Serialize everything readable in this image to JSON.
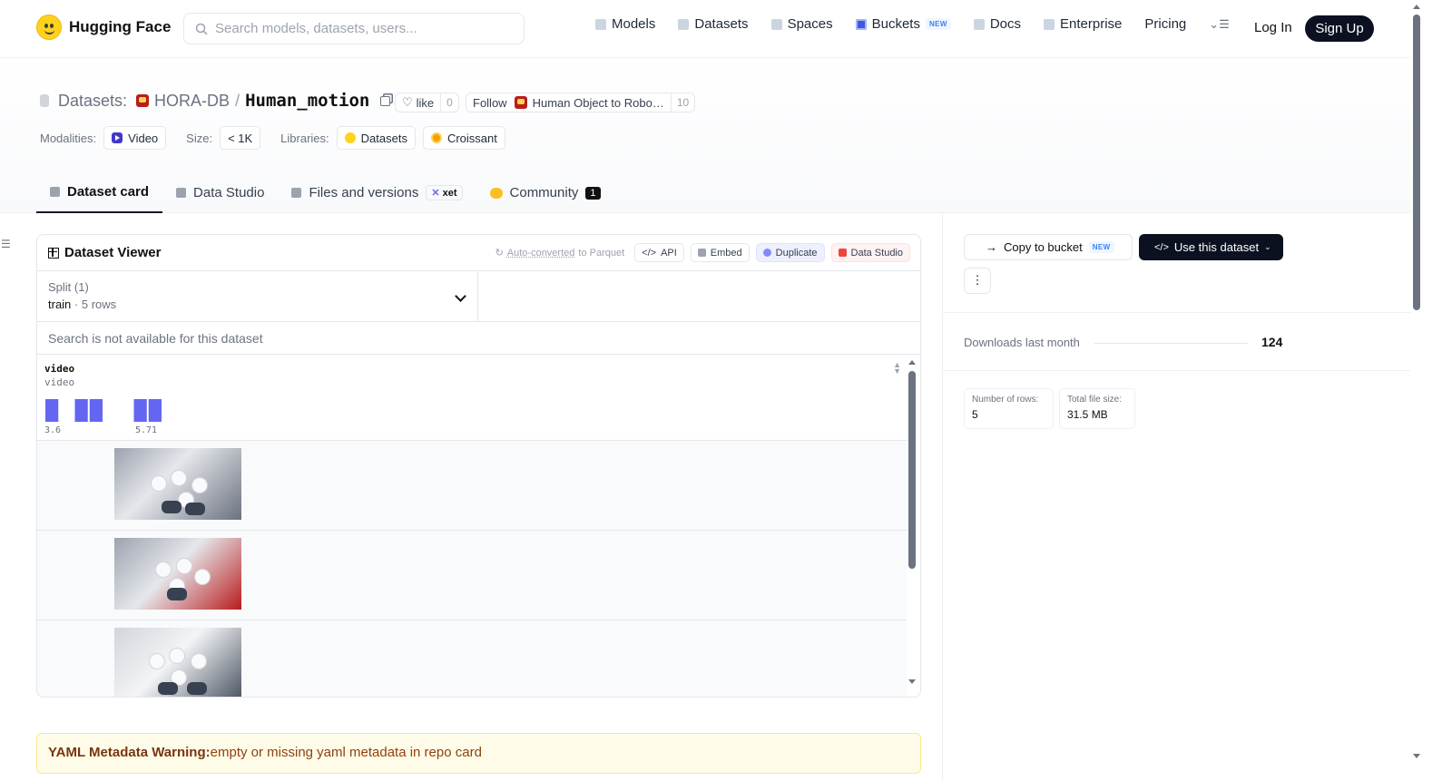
{
  "nav": {
    "brand": "Hugging Face",
    "search_placeholder": "Search models, datasets, users...",
    "links": [
      "Models",
      "Datasets",
      "Spaces",
      "Buckets",
      "Docs",
      "Enterprise",
      "Pricing"
    ],
    "buckets_badge": "NEW",
    "login": "Log In",
    "signup": "Sign Up"
  },
  "header": {
    "section": "Datasets:",
    "org": "HORA-DB",
    "slash": "/",
    "name": "Human_motion",
    "like_label": "like",
    "like_count": "0",
    "follow_label": "Follow",
    "follow_org": "Human Object to Robo…",
    "follow_count": "10",
    "modalities_label": "Modalities:",
    "modality": "Video",
    "size_label": "Size:",
    "size": "< 1K",
    "libraries_label": "Libraries:",
    "library_1": "Datasets",
    "library_2": "Croissant"
  },
  "tabs": {
    "card": "Dataset card",
    "studio": "Data Studio",
    "files": "Files and versions",
    "xet_badge_icon": "✕",
    "xet_badge": "xet",
    "community": "Community",
    "community_count": "1"
  },
  "viewer": {
    "title": "Dataset Viewer",
    "auto_converted": "Auto-converted",
    "to_parquet": "to Parquet",
    "api": "API",
    "embed": "Embed",
    "duplicate": "Duplicate",
    "data_studio": "Data Studio",
    "split_label": "Split (1)",
    "split_value": "train",
    "split_sep": "·",
    "split_rows": "5 rows",
    "search_disabled": "Search is not available for this dataset",
    "column": {
      "name": "video",
      "type": "video",
      "min_label": "3.6",
      "max_label": "5.71",
      "histogram_bins": [
        1,
        0,
        1,
        1,
        0,
        0,
        1,
        1
      ]
    }
  },
  "warning": {
    "title": "YAML Metadata Warning:",
    "text": "empty or missing yaml metadata in repo card"
  },
  "sidebar": {
    "copy_bucket": "Copy to bucket",
    "copy_bucket_badge": "NEW",
    "use_dataset": "Use this dataset",
    "kebab": "⋮",
    "downloads_label": "Downloads last month",
    "downloads": "124",
    "rows_label": "Number of rows:",
    "rows": "5",
    "size_label": "Total file size:",
    "size": "31.5 MB"
  },
  "colors": {
    "accent": "#6366f1",
    "dark": "#0b1120",
    "warning_bg": "#fefce8"
  }
}
